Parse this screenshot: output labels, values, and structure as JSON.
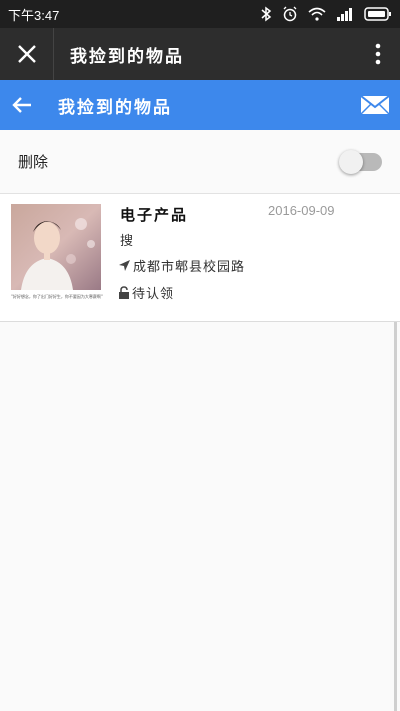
{
  "status_bar": {
    "time": "下午3:47"
  },
  "titlebar": {
    "title": "我捡到的物品"
  },
  "header": {
    "title": "我捡到的物品"
  },
  "delete_row": {
    "label": "删除",
    "toggle_on": false
  },
  "item": {
    "title": "电子产品",
    "date": "2016-09-09",
    "description": "搜",
    "location": "成都市郫县校园路",
    "status": "待认领",
    "thumb_caption": "\"好好想念，你了出门好好生，你不要因为大寒赛啊\""
  },
  "colors": {
    "header_blue": "#3d88ec",
    "titlebar": "#2d2d2d",
    "status_bar": "#1f1f1f"
  }
}
